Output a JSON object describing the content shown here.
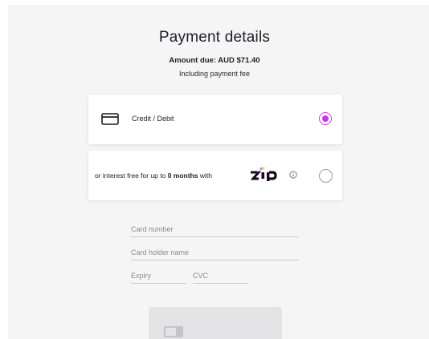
{
  "header": {
    "title": "Payment details",
    "amount_due": "Amount due: AUD $71.40",
    "fee_note": "Including payment fee"
  },
  "payment_options": {
    "credit": {
      "label": "Credit / Debit",
      "icon": "credit-card-icon",
      "selected": true
    },
    "zip": {
      "text_prefix": "or interest free for up to ",
      "text_bold": "0 months",
      "text_suffix": " with",
      "logo_text": "zip",
      "icon": "info-icon",
      "selected": false
    }
  },
  "form": {
    "card_number_placeholder": "Card number",
    "card_holder_placeholder": "Card holder name",
    "expiry_placeholder": "Expiry",
    "cvc_placeholder": "CVC"
  },
  "pay_button": {
    "icon": "card-icon",
    "enabled": false
  },
  "colors": {
    "background": "#f5f5f6",
    "accent": "#cc33ee",
    "text": "#1e1e28",
    "button_disabled": "#e3e3e5"
  }
}
